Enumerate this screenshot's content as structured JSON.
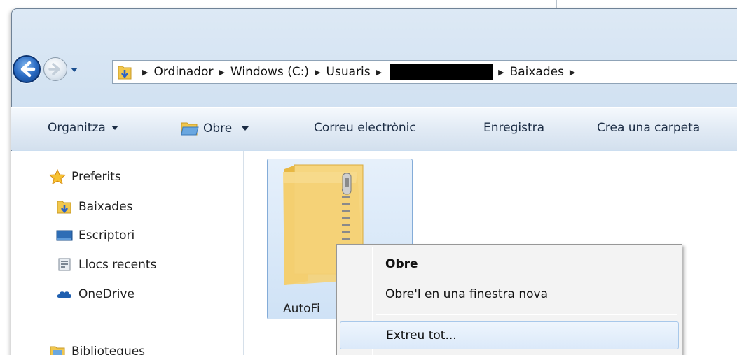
{
  "window": {
    "address_bar": {
      "crumbs": [
        "Ordinador",
        "Windows (C:)",
        "Usuaris",
        "Baixades"
      ],
      "redacted_crumb": true
    }
  },
  "toolbar": {
    "organize_label": "Organitza",
    "open_label": "Obre",
    "email_label": "Correu electrònic",
    "burn_label": "Enregistra",
    "new_folder_label": "Crea una carpeta"
  },
  "nav_pane": {
    "favorites_label": "Preferits",
    "items": [
      {
        "label": "Baixades",
        "icon": "downloads-folder-icon"
      },
      {
        "label": "Escriptori",
        "icon": "desktop-icon"
      },
      {
        "label": "Llocs recents",
        "icon": "recent-places-icon"
      },
      {
        "label": "OneDrive",
        "icon": "onedrive-icon"
      }
    ],
    "libraries_label": "Biblioteques"
  },
  "content": {
    "file_name": "AutoFi",
    "file_icon": "zip-folder-icon"
  },
  "context_menu": {
    "items": [
      {
        "label": "Obre",
        "bold": true
      },
      {
        "label": "Obre'l en una finestra nova",
        "bold": false
      },
      {
        "label": "Extreu tot...",
        "bold": false,
        "highlighted": true
      }
    ]
  },
  "colors": {
    "window_frame": "#c9dcef",
    "toolbar": "#e2ebf5",
    "selection": "#cfe2f6",
    "menu_background": "#f3f3f3"
  }
}
